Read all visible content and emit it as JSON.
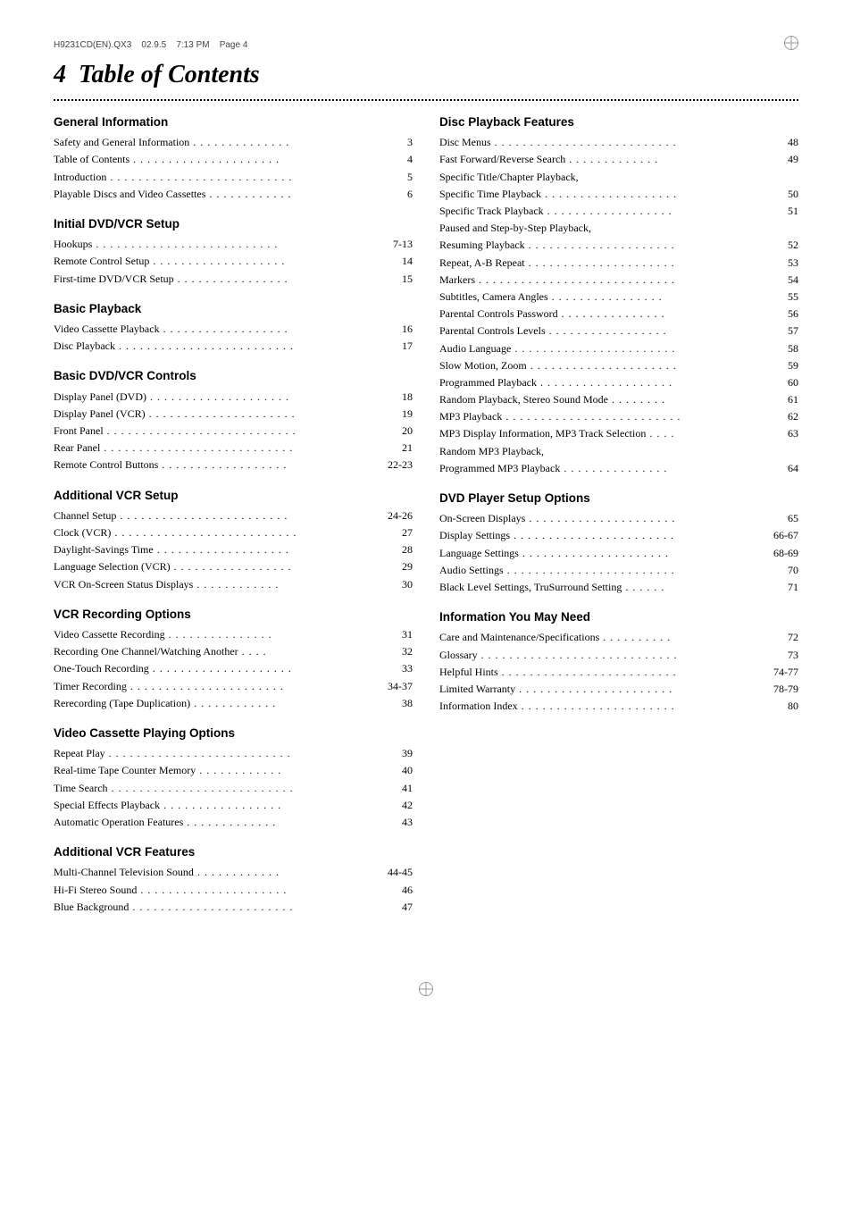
{
  "header": {
    "file": "H9231CD(EN).QX3",
    "date": "02.9.5",
    "time": "7:13 PM",
    "page": "Page 4"
  },
  "title": {
    "number": "4",
    "text": "Table of Contents"
  },
  "left_column": [
    {
      "section_title": "General Information",
      "entries": [
        {
          "text": "Safety and General Information",
          "dots": " . . . . . . . . . . . . . .",
          "page": "3"
        },
        {
          "text": "Table of Contents",
          "dots": " . . . . . . . . . . . . . . . . . . . . .",
          "page": "4"
        },
        {
          "text": "Introduction",
          "dots": " . . . . . . . . . . . . . . . . . . . . . . . . . .",
          "page": "5"
        },
        {
          "text": "Playable Discs and Video Cassettes",
          "dots": " . . . . . . . . . . . .",
          "page": "6"
        }
      ]
    },
    {
      "section_title": "Initial DVD/VCR Setup",
      "entries": [
        {
          "text": "Hookups",
          "dots": " . . . . . . . . . . . . . . . . . . . . . . . . . .",
          "page": "7-13"
        },
        {
          "text": "Remote Control Setup",
          "dots": " . . . . . . . . . . . . . . . . . . .",
          "page": "14"
        },
        {
          "text": "First-time DVD/VCR Setup",
          "dots": " . . . . . . . . . . . . . . . .",
          "page": "15"
        }
      ]
    },
    {
      "section_title": "Basic Playback",
      "entries": [
        {
          "text": "Video Cassette Playback",
          "dots": " . . . . . . . . . . . . . . . . . .",
          "page": "16"
        },
        {
          "text": "Disc Playback",
          "dots": " . . . . . . . . . . . . . . . . . . . . . . . . .",
          "page": "17"
        }
      ]
    },
    {
      "section_title": "Basic DVD/VCR Controls",
      "entries": [
        {
          "text": "Display Panel (DVD)",
          "dots": " . . . . . . . . . . . . . . . . . . . .",
          "page": "18"
        },
        {
          "text": "Display Panel (VCR)",
          "dots": " . . . . . . . . . . . . . . . . . . . . .",
          "page": "19"
        },
        {
          "text": "Front Panel",
          "dots": " . . . . . . . . . . . . . . . . . . . . . . . . . . .",
          "page": "20"
        },
        {
          "text": "Rear Panel",
          "dots": " . . . . . . . . . . . . . . . . . . . . . . . . . . .",
          "page": "21"
        },
        {
          "text": "Remote Control Buttons",
          "dots": " . . . . . . . . . . . . . . . . . .",
          "page": "22-23"
        }
      ]
    },
    {
      "section_title": "Additional VCR Setup",
      "entries": [
        {
          "text": "Channel Setup",
          "dots": " . . . . . . . . . . . . . . . . . . . . . . . .",
          "page": "24-26"
        },
        {
          "text": "Clock (VCR)",
          "dots": " . . . . . . . . . . . . . . . . . . . . . . . . . .",
          "page": "27"
        },
        {
          "text": "Daylight-Savings Time",
          "dots": " . . . . . . . . . . . . . . . . . . .",
          "page": "28"
        },
        {
          "text": "Language Selection (VCR)",
          "dots": " . . . . . . . . . . . . . . . . .",
          "page": "29"
        },
        {
          "text": "VCR On-Screen Status Displays",
          "dots": " . . . . . . . . . . . .",
          "page": "30"
        }
      ]
    },
    {
      "section_title": "VCR Recording Options",
      "entries": [
        {
          "text": "Video Cassette Recording",
          "dots": " . . . . . . . . . . . . . . .",
          "page": "31"
        },
        {
          "text": "Recording One Channel/Watching Another",
          "dots": " . . . .",
          "page": "32"
        },
        {
          "text": "One-Touch Recording",
          "dots": " . . . . . . . . . . . . . . . . . . . .",
          "page": "33"
        },
        {
          "text": "Timer Recording",
          "dots": " . . . . . . . . . . . . . . . . . . . . . .",
          "page": "34-37"
        },
        {
          "text": "Rerecording (Tape Duplication)",
          "dots": " . . . . . . . . . . . .",
          "page": "38"
        }
      ]
    },
    {
      "section_title": "Video Cassette Playing Options",
      "entries": [
        {
          "text": "Repeat Play",
          "dots": " . . . . . . . . . . . . . . . . . . . . . . . . . .",
          "page": "39"
        },
        {
          "text": "Real-time Tape Counter Memory",
          "dots": " . . . . . . . . . . . .",
          "page": "40"
        },
        {
          "text": "Time Search",
          "dots": " . . . . . . . . . . . . . . . . . . . . . . . . . .",
          "page": "41"
        },
        {
          "text": "Special Effects Playback",
          "dots": " . . . . . . . . . . . . . . . . .",
          "page": "42"
        },
        {
          "text": "Automatic Operation Features",
          "dots": " . . . . . . . . . . . . .",
          "page": "43"
        }
      ]
    },
    {
      "section_title": "Additional VCR Features",
      "entries": [
        {
          "text": "Multi-Channel Television Sound",
          "dots": " . . . . . . . . . . . .",
          "page": "44-45"
        },
        {
          "text": "Hi-Fi Stereo Sound",
          "dots": " . . . . . . . . . . . . . . . . . . . . .",
          "page": "46"
        },
        {
          "text": "Blue Background",
          "dots": " . . . . . . . . . . . . . . . . . . . . . . .",
          "page": "47"
        }
      ]
    }
  ],
  "right_column": [
    {
      "section_title": "Disc Playback Features",
      "entries": [
        {
          "text": "Disc Menus",
          "dots": " . . . . . . . . . . . . . . . . . . . . . . . . . .",
          "page": "48"
        },
        {
          "text": "Fast Forward/Reverse Search",
          "dots": " . . . . . . . . . . . . .",
          "page": "49"
        },
        {
          "text": "Specific Title/Chapter Playback,",
          "dots": "",
          "page": ""
        },
        {
          "text": "Specific Time Playback",
          "dots": " . . . . . . . . . . . . . . . . . . .",
          "page": "50"
        },
        {
          "text": "Specific Track Playback",
          "dots": " . . . . . . . . . . . . . . . . . .",
          "page": "51"
        },
        {
          "text": "Paused and Step-by-Step Playback,",
          "dots": "",
          "page": ""
        },
        {
          "text": "Resuming Playback",
          "dots": " . . . . . . . . . . . . . . . . . . . . .",
          "page": "52"
        },
        {
          "text": "Repeat, A-B Repeat",
          "dots": " . . . . . . . . . . . . . . . . . . . . .",
          "page": "53"
        },
        {
          "text": "Markers",
          "dots": " . . . . . . . . . . . . . . . . . . . . . . . . . . . .",
          "page": "54"
        },
        {
          "text": "Subtitles, Camera Angles",
          "dots": " . . . . . . . . . . . . . . . .",
          "page": "55"
        },
        {
          "text": "Parental Controls Password",
          "dots": " . . . . . . . . . . . . . . .",
          "page": "56"
        },
        {
          "text": "Parental Controls Levels",
          "dots": " . . . . . . . . . . . . . . . . .",
          "page": "57"
        },
        {
          "text": "Audio Language",
          "dots": " . . . . . . . . . . . . . . . . . . . . . . .",
          "page": "58"
        },
        {
          "text": "Slow Motion, Zoom",
          "dots": " . . . . . . . . . . . . . . . . . . . . .",
          "page": "59"
        },
        {
          "text": "Programmed Playback",
          "dots": " . . . . . . . . . . . . . . . . . . .",
          "page": "60"
        },
        {
          "text": "Random Playback, Stereo Sound Mode",
          "dots": " . . . . . . . .",
          "page": "61"
        },
        {
          "text": "MP3 Playback",
          "dots": " . . . . . . . . . . . . . . . . . . . . . . . . .",
          "page": "62"
        },
        {
          "text": "MP3 Display Information, MP3 Track Selection",
          "dots": " . . . .",
          "page": "63"
        },
        {
          "text": "Random MP3 Playback,",
          "dots": "",
          "page": ""
        },
        {
          "text": "Programmed MP3 Playback",
          "dots": " . . . . . . . . . . . . . . .",
          "page": "64"
        }
      ]
    },
    {
      "section_title": "DVD Player Setup Options",
      "entries": [
        {
          "text": "On-Screen Displays",
          "dots": " . . . . . . . . . . . . . . . . . . . . .",
          "page": "65"
        },
        {
          "text": "Display Settings",
          "dots": " . . . . . . . . . . . . . . . . . . . . . . .",
          "page": "66-67"
        },
        {
          "text": "Language Settings",
          "dots": " . . . . . . . . . . . . . . . . . . . . .",
          "page": "68-69"
        },
        {
          "text": "Audio Settings",
          "dots": " . . . . . . . . . . . . . . . . . . . . . . . .",
          "page": "70"
        },
        {
          "text": "Black Level Settings, TruSurround Setting",
          "dots": " . . . . . .",
          "page": "71"
        }
      ]
    },
    {
      "section_title": "Information You May Need",
      "entries": [
        {
          "text": "Care and Maintenance/Specifications",
          "dots": " . . . . . . . . . .",
          "page": "72"
        },
        {
          "text": "Glossary",
          "dots": " . . . . . . . . . . . . . . . . . . . . . . . . . . . .",
          "page": "73"
        },
        {
          "text": "Helpful Hints",
          "dots": " . . . . . . . . . . . . . . . . . . . . . . . . .",
          "page": "74-77"
        },
        {
          "text": "Limited Warranty",
          "dots": " . . . . . . . . . . . . . . . . . . . . . .",
          "page": "78-79"
        },
        {
          "text": "Information Index",
          "dots": " . . . . . . . . . . . . . . . . . . . . . .",
          "page": "80"
        }
      ]
    }
  ]
}
